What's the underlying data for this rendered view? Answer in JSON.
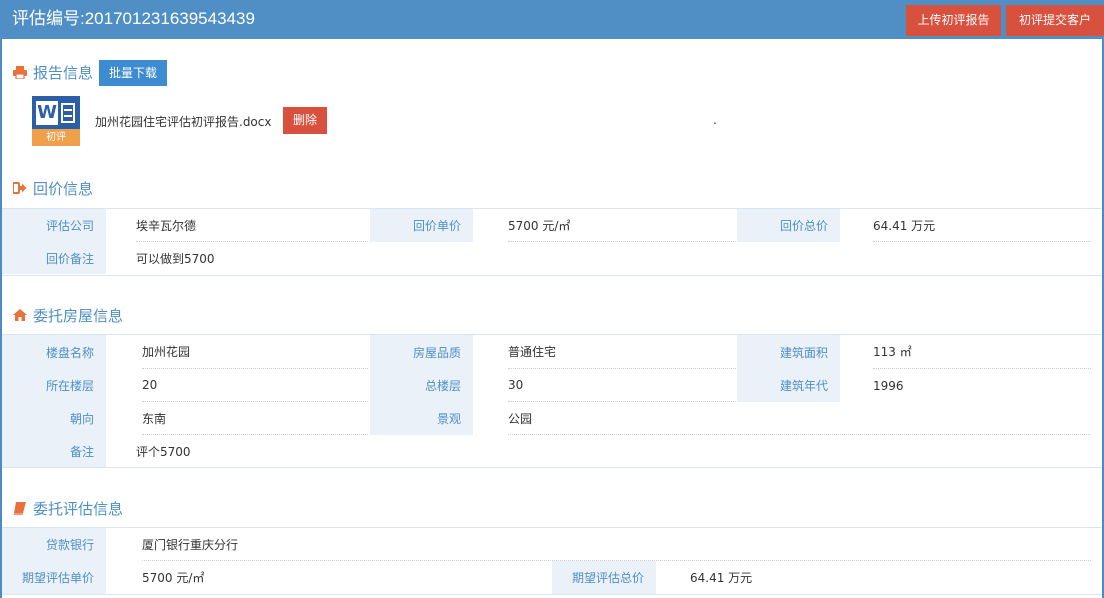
{
  "header": {
    "title": "评估编号:201701231639543439",
    "upload_button": "上传初评报告",
    "submit_button": "初评提交客户"
  },
  "report": {
    "section_title": "报告信息",
    "batch_download": "批量下载",
    "file": {
      "icon_badge": "初评",
      "name": "加州花园住宅评估初评报告.docx",
      "delete_button": "删除"
    },
    "dot": "."
  },
  "quote": {
    "section_title": "回价信息",
    "rows": [
      {
        "label": "评估公司",
        "value": "埃辛瓦尔德",
        "label2": "回价单价",
        "value2": "5700 元/㎡",
        "label3": "回价总价",
        "value3": "64.41 万元"
      },
      {
        "label": "回价备注",
        "value": "可以做到5700"
      }
    ]
  },
  "house": {
    "section_title": "委托房屋信息",
    "rows": [
      {
        "label": "楼盘名称",
        "value": "加州花园",
        "label2": "房屋品质",
        "value2": "普通住宅",
        "label3": "建筑面积",
        "value3": "113 ㎡"
      },
      {
        "label": "所在楼层",
        "value": "20",
        "label2": "总楼层",
        "value2": "30",
        "label3": "建筑年代",
        "value3": "1996"
      },
      {
        "label": "朝向",
        "value": "东南",
        "label2": "景观",
        "value2": "公园"
      },
      {
        "label": "备注",
        "value": "评个5700"
      }
    ]
  },
  "appraisal": {
    "section_title": "委托评估信息",
    "rows": [
      {
        "label": "贷款银行",
        "value": "厦门银行重庆分行"
      },
      {
        "label": "期望评估单价",
        "value": "5700 元/㎡",
        "label2": "期望评估总价",
        "value2": "64.41 万元"
      }
    ]
  },
  "colors": {
    "header_bg": "#4f8fc5",
    "danger": "#d8513f",
    "primary": "#3d8bd1",
    "label_bg": "#eaf1f8",
    "icon_orange": "#e8713c"
  }
}
